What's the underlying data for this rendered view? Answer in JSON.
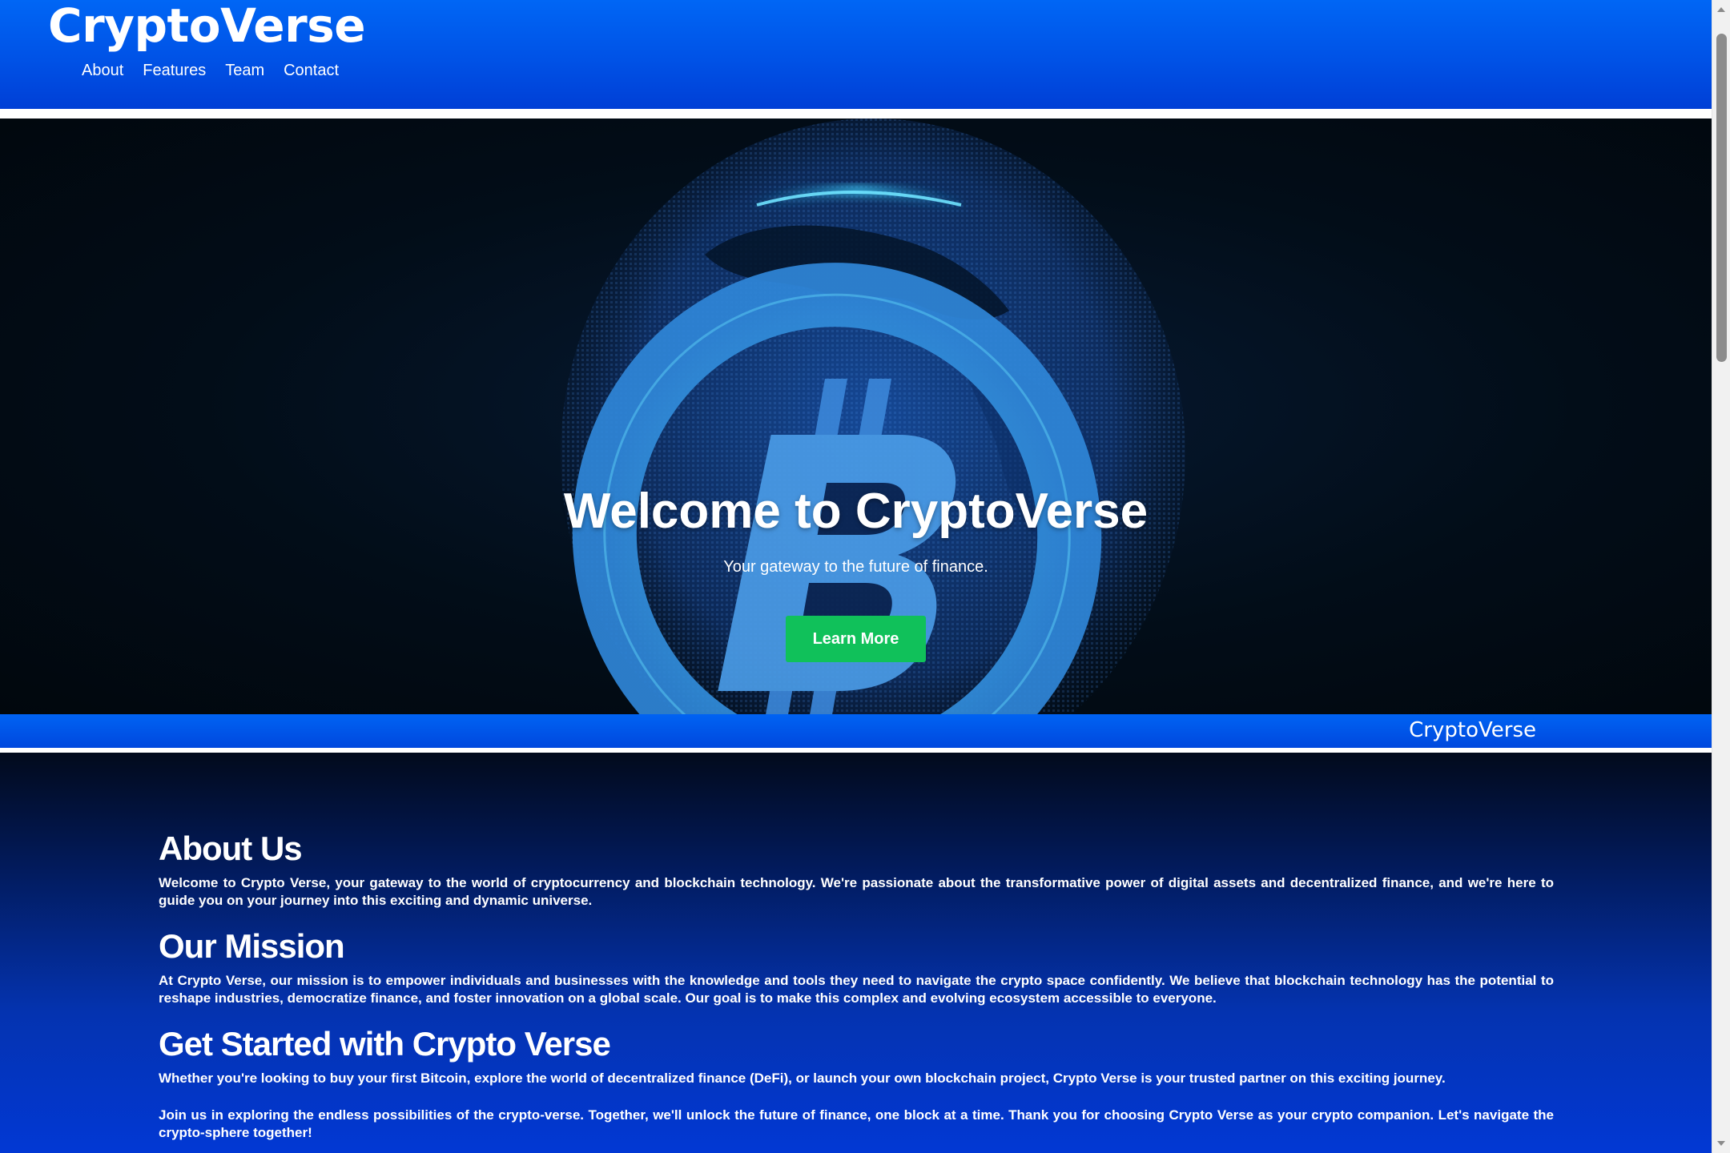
{
  "header": {
    "logo": "CryptoVerse",
    "nav": [
      "About",
      "Features",
      "Team",
      "Contact"
    ]
  },
  "hero": {
    "title": "Welcome to CryptoVerse",
    "subtitle": "Your gateway to the future of finance.",
    "button_label": "Learn More"
  },
  "brand_strip": {
    "text": "CryptoVerse"
  },
  "sections": {
    "about": {
      "heading": "About Us",
      "body": "Welcome to Crypto Verse, your gateway to the world of cryptocurrency and blockchain technology. We're passionate about the transformative power of digital assets and decentralized finance, and we're here to guide you on your journey into this exciting and dynamic universe."
    },
    "mission": {
      "heading": "Our Mission",
      "body": "At Crypto Verse, our mission is to empower individuals and businesses with the knowledge and tools they need to navigate the crypto space confidently. We believe that blockchain technology has the potential to reshape industries, democratize finance, and foster innovation on a global scale. Our goal is to make this complex and evolving ecosystem accessible to everyone."
    },
    "get_started": {
      "heading": "Get Started with Crypto Verse",
      "body1": "Whether you're looking to buy your first Bitcoin, explore the world of decentralized finance (DeFi), or launch your own blockchain project, Crypto Verse is your trusted partner on this exciting journey.",
      "body2": "Join us in exploring the endless possibilities of the crypto-verse. Together, we'll unlock the future of finance, one block at a time. Thank you for choosing Crypto Verse as your crypto companion. Let's navigate the crypto-sphere together!"
    }
  },
  "colors": {
    "header_blue": "#0052e6",
    "button_green": "#10c15a",
    "hero_dark": "#020d18",
    "content_deep_blue": "#021a5a"
  },
  "icons": {
    "hero_art": "bitcoin-globe-icon",
    "scroll_up": "scroll-up-arrow-icon",
    "scroll_down": "scroll-down-arrow-icon"
  }
}
